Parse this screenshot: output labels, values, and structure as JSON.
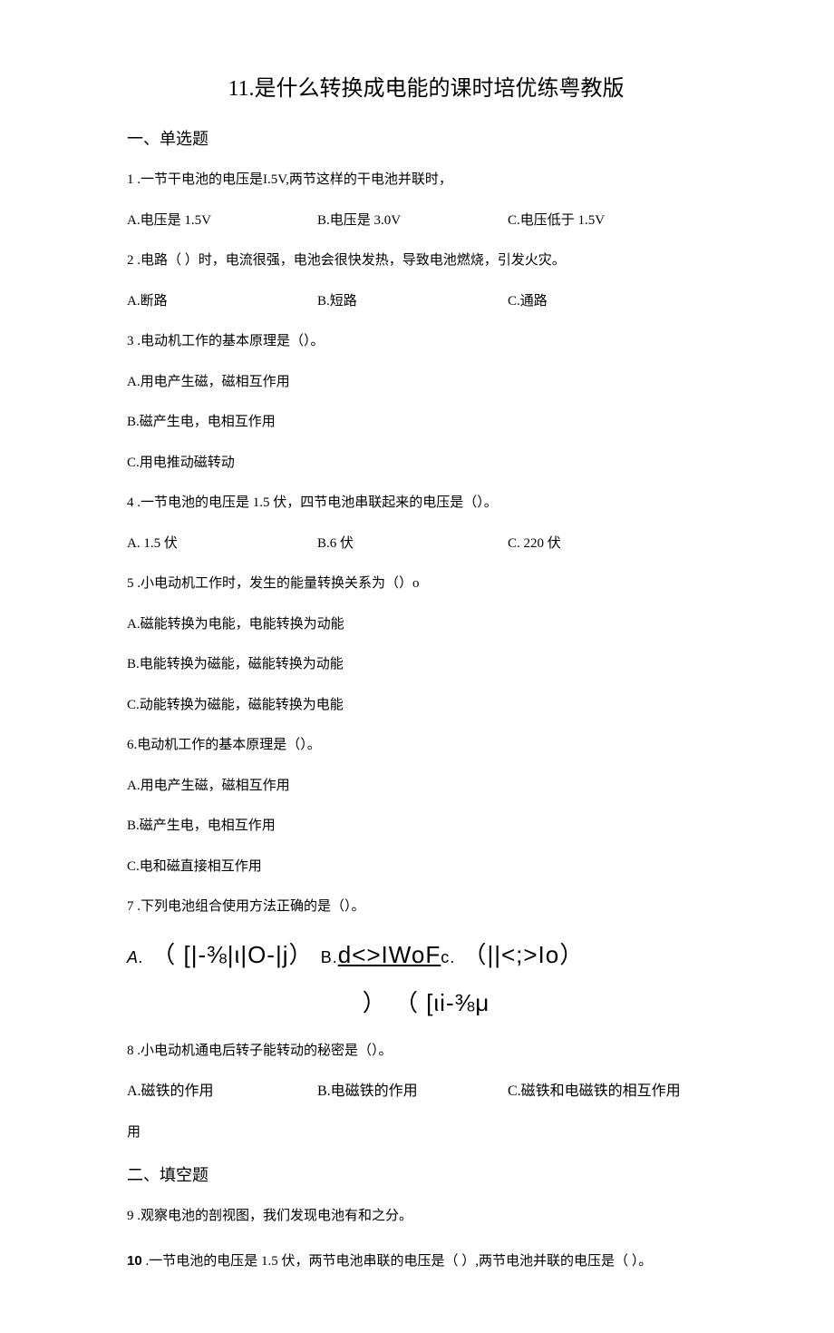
{
  "title": "11.是什么转换成电能的课时培优练粤教版",
  "section1": "一、单选题",
  "q1": {
    "stem": "1 .一节干电池的电压是I.5V,两节这样的干电池并联时，",
    "a": "A.电压是 1.5V",
    "b": "B.电压是 3.0V",
    "c": "C.电压低于 1.5V"
  },
  "q2": {
    "stem": "2   .电路（    ）时，电流很强，电池会很快发热，导致电池燃烧，引发火灾。",
    "a": "A.断路",
    "b": "B.短路",
    "c": "C.通路"
  },
  "q3": {
    "stem": "3   .电动机工作的基本原理是（）。",
    "a": "A.用电产生磁，磁相互作用",
    "b": "B.磁产生电，电相互作用",
    "c": "C.用电推动磁转动"
  },
  "q4": {
    "stem": "4   .一节电池的电压是 1.5 伏，四节电池串联起来的电压是（）。",
    "a": "A. 1.5 伏",
    "b": "B.6 伏",
    "c": "C. 220 伏"
  },
  "q5": {
    "stem": "5   .小电动机工作时，发生的能量转换关系为（）o",
    "a": "A.磁能转换为电能，电能转换为动能",
    "b": "B.电能转换为磁能，磁能转换为动能",
    "c": "C.动能转换为磁能，磁能转换为电能"
  },
  "q6": {
    "stem": "6.电动机工作的基本原理是（）。",
    "a": "A.用电产生磁，磁相互作用",
    "b": "B.磁产生电，电相互作用",
    "c": "C.电和磁直接相互作用"
  },
  "q7": {
    "stem": "7 .下列电池组合使用方法正确的是（）。",
    "special_prefix_a": "A.",
    "special_a": "（ [|-⅜|ι|O-|j） ",
    "special_prefix_b": "B.",
    "special_b": "d<>IWoF",
    "special_prefix_c": "c.",
    "special_c": "（||<;>Io）",
    "special_sub": "）  （ [ιi-⅜μ"
  },
  "q8": {
    "stem": "8   .小电动机通电后转子能转动的秘密是（）。",
    "a": "A.磁铁的作用",
    "b": "B.电磁铁的作用",
    "c": "C.磁铁和电磁铁的相互作用"
  },
  "section2": "二、填空题",
  "q9": "9   .观察电池的剖视图，我们发现电池有和之分。",
  "q10_num": "10",
  "q10_rest": "  .一节电池的电压是 1.5 伏，两节电池串联的电压是（      ）,两节电池并联的电压是（      ）。"
}
